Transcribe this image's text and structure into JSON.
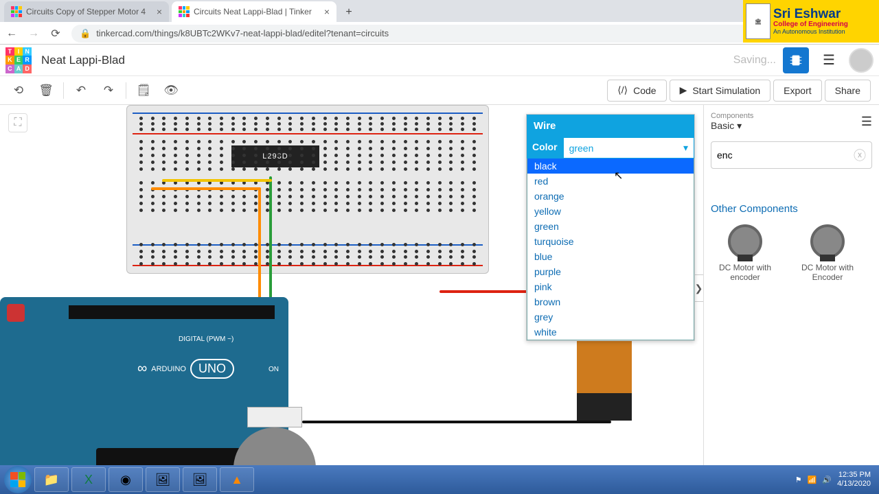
{
  "browser": {
    "tabs": [
      {
        "title": "Circuits Copy of Stepper Motor 4"
      },
      {
        "title": "Circuits Neat Lappi-Blad | Tinker"
      }
    ],
    "url": "tinkercad.com/things/k8UBTc2WKv7-neat-lappi-blad/editel?tenant=circuits"
  },
  "college": {
    "name": "Sri Eshwar",
    "sub": "College of Engineering",
    "ssub": "An Autonomous Institution"
  },
  "app": {
    "project_name": "Neat Lappi-Blad",
    "saving_label": "Saving...",
    "code_label": "Code",
    "sim_label": "Start Simulation",
    "export_label": "Export",
    "share_label": "Share"
  },
  "chip_label": "L293D",
  "arduino": {
    "brand": "ARDUINO",
    "model": "UNO",
    "pwm": "DIGITAL (PWM ~)",
    "on": "ON"
  },
  "property_panel": {
    "title": "Wire",
    "color_label": "Color",
    "selected": "green",
    "options": [
      "black",
      "red",
      "orange",
      "yellow",
      "green",
      "turquoise",
      "blue",
      "purple",
      "pink",
      "brown",
      "grey",
      "white"
    ],
    "highlighted": "black"
  },
  "right_panel": {
    "components_label": "Components",
    "group": "Basic",
    "search_value": "enc",
    "other_label": "Other Components",
    "items": [
      {
        "label": "DC Motor with encoder"
      },
      {
        "label": "DC Motor with Encoder"
      }
    ]
  },
  "taskbar": {
    "time": "12:35 PM",
    "date": "4/13/2020"
  }
}
